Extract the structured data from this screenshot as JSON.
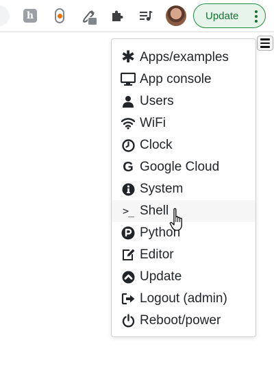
{
  "toolbar": {
    "update_label": "Update",
    "extensions": [
      {
        "icon": "h-extension-icon"
      },
      {
        "icon": "pill-extension-icon"
      },
      {
        "icon": "eyedropper-extension-icon"
      },
      {
        "icon": "puzzle-extensions-icon"
      },
      {
        "icon": "media-control-icon"
      }
    ]
  },
  "menu": {
    "items": [
      {
        "label": "Apps/examples",
        "icon": "asterisk-icon"
      },
      {
        "label": "App console",
        "icon": "monitor-icon"
      },
      {
        "label": "Users",
        "icon": "user-icon"
      },
      {
        "label": "WiFi",
        "icon": "wifi-icon"
      },
      {
        "label": "Clock",
        "icon": "clock-icon"
      },
      {
        "label": "Google Cloud",
        "icon": "google-icon"
      },
      {
        "label": "System",
        "icon": "info-icon"
      },
      {
        "label": "Shell",
        "icon": "terminal-prompt-icon"
      },
      {
        "label": "Python",
        "icon": "python-p-icon"
      },
      {
        "label": "Editor",
        "icon": "edit-icon"
      },
      {
        "label": "Update",
        "icon": "chevron-up-circle-icon"
      },
      {
        "label": "Logout (admin)",
        "icon": "sign-out-icon"
      },
      {
        "label": "Reboot/power",
        "icon": "power-icon"
      }
    ],
    "hovered": "Shell"
  },
  "colors": {
    "update_button_border": "#1e8e3e",
    "update_button_bg": "#e6f4ea",
    "update_button_text": "#137333",
    "menu_text": "#212529",
    "hover_bg": "#f6f6f6"
  }
}
